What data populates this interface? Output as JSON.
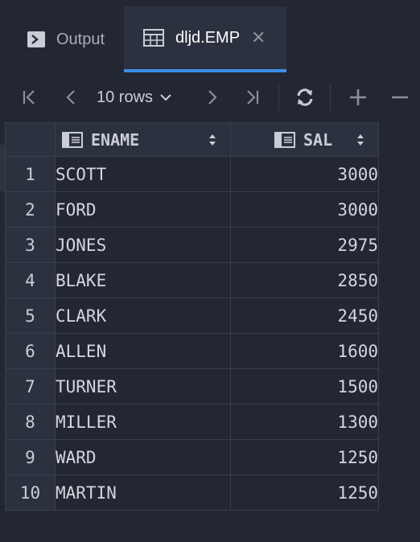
{
  "tabs": [
    {
      "label": "Output",
      "icon": "terminal-icon",
      "active": false
    },
    {
      "label": "dljd.EMP",
      "icon": "table-icon",
      "active": true,
      "closable": true
    }
  ],
  "toolbar": {
    "rows_label": "10 rows",
    "buttons": [
      "first-page-icon",
      "prev-page-icon",
      "next-page-icon",
      "last-page-icon",
      "refresh-icon",
      "add-row-icon",
      "remove-row-icon"
    ]
  },
  "grid": {
    "columns": [
      "ENAME",
      "SAL"
    ],
    "rows": [
      {
        "idx": "1",
        "ename": "SCOTT",
        "sal": "3000"
      },
      {
        "idx": "2",
        "ename": "FORD",
        "sal": "3000"
      },
      {
        "idx": "3",
        "ename": "JONES",
        "sal": "2975"
      },
      {
        "idx": "4",
        "ename": "BLAKE",
        "sal": "2850"
      },
      {
        "idx": "5",
        "ename": "CLARK",
        "sal": "2450"
      },
      {
        "idx": "6",
        "ename": "ALLEN",
        "sal": "1600"
      },
      {
        "idx": "7",
        "ename": "TURNER",
        "sal": "1500"
      },
      {
        "idx": "8",
        "ename": "MILLER",
        "sal": "1300"
      },
      {
        "idx": "9",
        "ename": "WARD",
        "sal": "1250"
      },
      {
        "idx": "10",
        "ename": "MARTIN",
        "sal": "1250"
      }
    ]
  },
  "colors": {
    "background": "#232733",
    "panel": "#2c3140",
    "accent": "#3d8fe6",
    "border": "#3a3f4c"
  }
}
